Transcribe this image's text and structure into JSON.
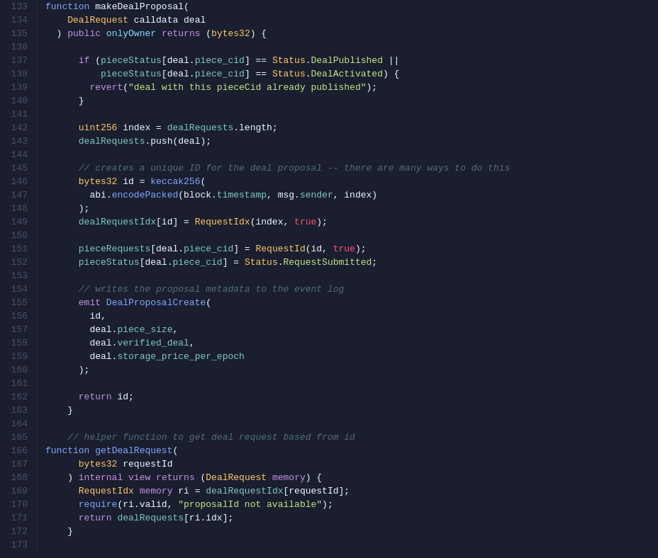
{
  "editor": {
    "background": "#1a1e2e",
    "lines": [
      {
        "num": 133,
        "tokens": [
          {
            "t": "fn",
            "v": "function"
          },
          {
            "t": "plain",
            "v": " makeDealProposal("
          }
        ]
      },
      {
        "num": 134,
        "tokens": [
          {
            "t": "plain",
            "v": "    "
          },
          {
            "t": "type",
            "v": "DealRequest"
          },
          {
            "t": "plain",
            "v": " calldata deal"
          }
        ]
      },
      {
        "num": 135,
        "tokens": [
          {
            "t": "plain",
            "v": "  ) "
          },
          {
            "t": "kw",
            "v": "public"
          },
          {
            "t": "plain",
            "v": " "
          },
          {
            "t": "kw2",
            "v": "onlyOwner"
          },
          {
            "t": "plain",
            "v": " "
          },
          {
            "t": "kw",
            "v": "returns"
          },
          {
            "t": "plain",
            "v": " ("
          },
          {
            "t": "type",
            "v": "bytes32"
          },
          {
            "t": "plain",
            "v": ") {"
          }
        ]
      },
      {
        "num": 136,
        "tokens": []
      },
      {
        "num": 137,
        "tokens": [
          {
            "t": "plain",
            "v": "      "
          },
          {
            "t": "kw",
            "v": "if"
          },
          {
            "t": "plain",
            "v": " ("
          },
          {
            "t": "prop",
            "v": "pieceStatus"
          },
          {
            "t": "plain",
            "v": "[deal."
          },
          {
            "t": "prop",
            "v": "piece_cid"
          },
          {
            "t": "plain",
            "v": "] == "
          },
          {
            "t": "type",
            "v": "Status"
          },
          {
            "t": "plain",
            "v": "."
          },
          {
            "t": "status",
            "v": "DealPublished"
          },
          {
            "t": "plain",
            "v": " ||"
          }
        ]
      },
      {
        "num": 138,
        "tokens": [
          {
            "t": "plain",
            "v": "          "
          },
          {
            "t": "prop",
            "v": "pieceStatus"
          },
          {
            "t": "plain",
            "v": "[deal."
          },
          {
            "t": "prop",
            "v": "piece_cid"
          },
          {
            "t": "plain",
            "v": "] == "
          },
          {
            "t": "type",
            "v": "Status"
          },
          {
            "t": "plain",
            "v": "."
          },
          {
            "t": "status",
            "v": "DealActivated"
          },
          {
            "t": "plain",
            "v": ") {"
          }
        ]
      },
      {
        "num": 139,
        "tokens": [
          {
            "t": "plain",
            "v": "        "
          },
          {
            "t": "kw",
            "v": "revert"
          },
          {
            "t": "plain",
            "v": "("
          },
          {
            "t": "str",
            "v": "\"deal with this pieceCid already published\""
          },
          {
            "t": "plain",
            "v": ");"
          }
        ]
      },
      {
        "num": 140,
        "tokens": [
          {
            "t": "plain",
            "v": "      }"
          }
        ]
      },
      {
        "num": 141,
        "tokens": []
      },
      {
        "num": 142,
        "tokens": [
          {
            "t": "plain",
            "v": "      "
          },
          {
            "t": "type",
            "v": "uint256"
          },
          {
            "t": "plain",
            "v": " index = "
          },
          {
            "t": "prop",
            "v": "dealRequests"
          },
          {
            "t": "plain",
            "v": ".length;"
          }
        ]
      },
      {
        "num": 143,
        "tokens": [
          {
            "t": "plain",
            "v": "      "
          },
          {
            "t": "prop",
            "v": "dealRequests"
          },
          {
            "t": "plain",
            "v": ".push(deal);"
          }
        ]
      },
      {
        "num": 144,
        "tokens": []
      },
      {
        "num": 145,
        "tokens": [
          {
            "t": "comment",
            "v": "      // creates a unique ID for the deal proposal -- there are many ways to do this"
          }
        ]
      },
      {
        "num": 146,
        "tokens": [
          {
            "t": "plain",
            "v": "      "
          },
          {
            "t": "type",
            "v": "bytes32"
          },
          {
            "t": "plain",
            "v": " id = "
          },
          {
            "t": "fn",
            "v": "keccak256"
          },
          {
            "t": "plain",
            "v": "("
          }
        ]
      },
      {
        "num": 147,
        "tokens": [
          {
            "t": "plain",
            "v": "        abi."
          },
          {
            "t": "fn",
            "v": "encodePacked"
          },
          {
            "t": "plain",
            "v": "(block."
          },
          {
            "t": "prop",
            "v": "timestamp"
          },
          {
            "t": "plain",
            "v": ", msg."
          },
          {
            "t": "prop",
            "v": "sender"
          },
          {
            "t": "plain",
            "v": ", index)"
          }
        ]
      },
      {
        "num": 148,
        "tokens": [
          {
            "t": "plain",
            "v": "      );"
          }
        ]
      },
      {
        "num": 149,
        "tokens": [
          {
            "t": "plain",
            "v": "      "
          },
          {
            "t": "prop",
            "v": "dealRequestIdx"
          },
          {
            "t": "plain",
            "v": "[id] = "
          },
          {
            "t": "type",
            "v": "RequestIdx"
          },
          {
            "t": "plain",
            "v": "(index, "
          },
          {
            "t": "bool",
            "v": "true"
          },
          {
            "t": "plain",
            "v": ");"
          }
        ]
      },
      {
        "num": 150,
        "tokens": []
      },
      {
        "num": 151,
        "tokens": [
          {
            "t": "plain",
            "v": "      "
          },
          {
            "t": "prop",
            "v": "pieceRequests"
          },
          {
            "t": "plain",
            "v": "[deal."
          },
          {
            "t": "prop",
            "v": "piece_cid"
          },
          {
            "t": "plain",
            "v": "] = "
          },
          {
            "t": "type",
            "v": "RequestId"
          },
          {
            "t": "plain",
            "v": "(id, "
          },
          {
            "t": "bool",
            "v": "true"
          },
          {
            "t": "plain",
            "v": ");"
          }
        ]
      },
      {
        "num": 152,
        "tokens": [
          {
            "t": "plain",
            "v": "      "
          },
          {
            "t": "prop",
            "v": "pieceStatus"
          },
          {
            "t": "plain",
            "v": "[deal."
          },
          {
            "t": "prop",
            "v": "piece_cid"
          },
          {
            "t": "plain",
            "v": "] = "
          },
          {
            "t": "type",
            "v": "Status"
          },
          {
            "t": "plain",
            "v": "."
          },
          {
            "t": "status",
            "v": "RequestSubmitted"
          },
          {
            "t": "plain",
            "v": ";"
          }
        ]
      },
      {
        "num": 153,
        "tokens": []
      },
      {
        "num": 154,
        "tokens": [
          {
            "t": "comment",
            "v": "      // writes the proposal metadata to the event log"
          }
        ]
      },
      {
        "num": 155,
        "tokens": [
          {
            "t": "plain",
            "v": "      "
          },
          {
            "t": "kw",
            "v": "emit"
          },
          {
            "t": "plain",
            "v": " "
          },
          {
            "t": "fn",
            "v": "DealProposalCreate"
          },
          {
            "t": "plain",
            "v": "("
          }
        ]
      },
      {
        "num": 156,
        "tokens": [
          {
            "t": "plain",
            "v": "        id,"
          }
        ]
      },
      {
        "num": 157,
        "tokens": [
          {
            "t": "plain",
            "v": "        deal."
          },
          {
            "t": "prop",
            "v": "piece_size"
          },
          {
            "t": "plain",
            "v": ","
          }
        ]
      },
      {
        "num": 158,
        "tokens": [
          {
            "t": "plain",
            "v": "        deal."
          },
          {
            "t": "prop",
            "v": "verified_deal"
          },
          {
            "t": "plain",
            "v": ","
          }
        ]
      },
      {
        "num": 159,
        "tokens": [
          {
            "t": "plain",
            "v": "        deal."
          },
          {
            "t": "prop",
            "v": "storage_price_per_epoch"
          }
        ]
      },
      {
        "num": 160,
        "tokens": [
          {
            "t": "plain",
            "v": "      );"
          }
        ]
      },
      {
        "num": 161,
        "tokens": []
      },
      {
        "num": 162,
        "tokens": [
          {
            "t": "plain",
            "v": "      "
          },
          {
            "t": "kw",
            "v": "return"
          },
          {
            "t": "plain",
            "v": " id;"
          }
        ]
      },
      {
        "num": 163,
        "tokens": [
          {
            "t": "plain",
            "v": "    }"
          }
        ]
      },
      {
        "num": 164,
        "tokens": []
      },
      {
        "num": 165,
        "tokens": [
          {
            "t": "comment",
            "v": "    // helper function to get deal request based from id"
          }
        ]
      },
      {
        "num": 166,
        "tokens": [
          {
            "t": "fn",
            "v": "function"
          },
          {
            "t": "plain",
            "v": " "
          },
          {
            "t": "fn",
            "v": "getDealRequest"
          },
          {
            "t": "plain",
            "v": "("
          }
        ]
      },
      {
        "num": 167,
        "tokens": [
          {
            "t": "plain",
            "v": "      "
          },
          {
            "t": "type",
            "v": "bytes32"
          },
          {
            "t": "plain",
            "v": " requestId"
          }
        ]
      },
      {
        "num": 168,
        "tokens": [
          {
            "t": "plain",
            "v": "    ) "
          },
          {
            "t": "kw",
            "v": "internal"
          },
          {
            "t": "plain",
            "v": " "
          },
          {
            "t": "kw",
            "v": "view"
          },
          {
            "t": "plain",
            "v": " "
          },
          {
            "t": "kw",
            "v": "returns"
          },
          {
            "t": "plain",
            "v": " ("
          },
          {
            "t": "type",
            "v": "DealRequest"
          },
          {
            "t": "plain",
            "v": " "
          },
          {
            "t": "kw",
            "v": "memory"
          },
          {
            "t": "plain",
            "v": ") {"
          }
        ]
      },
      {
        "num": 169,
        "tokens": [
          {
            "t": "plain",
            "v": "      "
          },
          {
            "t": "type",
            "v": "RequestIdx"
          },
          {
            "t": "plain",
            "v": " "
          },
          {
            "t": "kw",
            "v": "memory"
          },
          {
            "t": "plain",
            "v": " ri = "
          },
          {
            "t": "prop",
            "v": "dealRequestIdx"
          },
          {
            "t": "plain",
            "v": "[requestId];"
          }
        ]
      },
      {
        "num": 170,
        "tokens": [
          {
            "t": "plain",
            "v": "      "
          },
          {
            "t": "fn",
            "v": "require"
          },
          {
            "t": "plain",
            "v": "(ri.valid, "
          },
          {
            "t": "str",
            "v": "\"proposalId not available\""
          },
          {
            "t": "plain",
            "v": ");"
          }
        ]
      },
      {
        "num": 171,
        "tokens": [
          {
            "t": "plain",
            "v": "      "
          },
          {
            "t": "kw",
            "v": "return"
          },
          {
            "t": "plain",
            "v": " "
          },
          {
            "t": "prop",
            "v": "dealRequests"
          },
          {
            "t": "plain",
            "v": "[ri.idx];"
          }
        ]
      },
      {
        "num": 172,
        "tokens": [
          {
            "t": "plain",
            "v": "    }"
          }
        ]
      },
      {
        "num": 173,
        "tokens": []
      }
    ]
  }
}
